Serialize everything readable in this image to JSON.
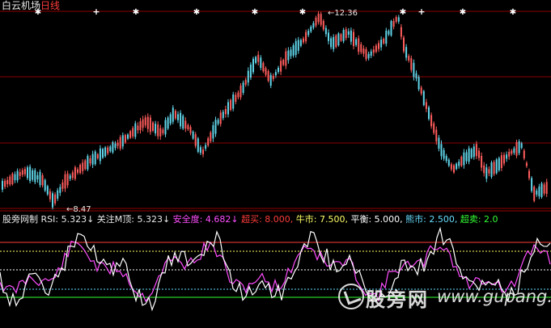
{
  "header": {
    "stock_name": "白云机场",
    "period": "日线"
  },
  "price_chart": {
    "high_label": "12.36",
    "low_label": "8.47",
    "colors": {
      "up": "#ff5c5c",
      "down": "#5fd4e8",
      "grid_red": "#8b0000",
      "marker": "#ffffff"
    }
  },
  "indicator": {
    "name": "股旁网制",
    "items": [
      {
        "label": "RSI:",
        "value": "5.323",
        "arrow": "↓",
        "color": "#e8e8e8"
      },
      {
        "label": "关注M顶:",
        "value": "5.323",
        "arrow": "↓",
        "color": "#e8e8e8"
      },
      {
        "label": "安全度:",
        "value": "4.682",
        "arrow": "↓",
        "color": "#ff4dff"
      },
      {
        "label": "超买:",
        "value": "8.000,",
        "arrow": "",
        "color": "#ff3b3b"
      },
      {
        "label": "牛市:",
        "value": "7.500,",
        "arrow": "",
        "color": "#ffff66"
      },
      {
        "label": "平衡:",
        "value": "5.000,",
        "arrow": "",
        "color": "#ffffff"
      },
      {
        "label": "熊市:",
        "value": "2.500,",
        "arrow": "",
        "color": "#66ddff"
      },
      {
        "label": "超卖:",
        "value": "2.0",
        "arrow": "",
        "color": "#33ff33"
      }
    ],
    "colors": {
      "rsi": "#ffffff",
      "safety": "#ff4dff",
      "overbought": "#ff3b3b",
      "bull": "#ffff66",
      "balance": "#ffffff",
      "bear": "#66ddff",
      "oversold": "#33ff33"
    }
  },
  "watermark": {
    "cn": "股旁网",
    "url": "www.gupang.com"
  }
}
